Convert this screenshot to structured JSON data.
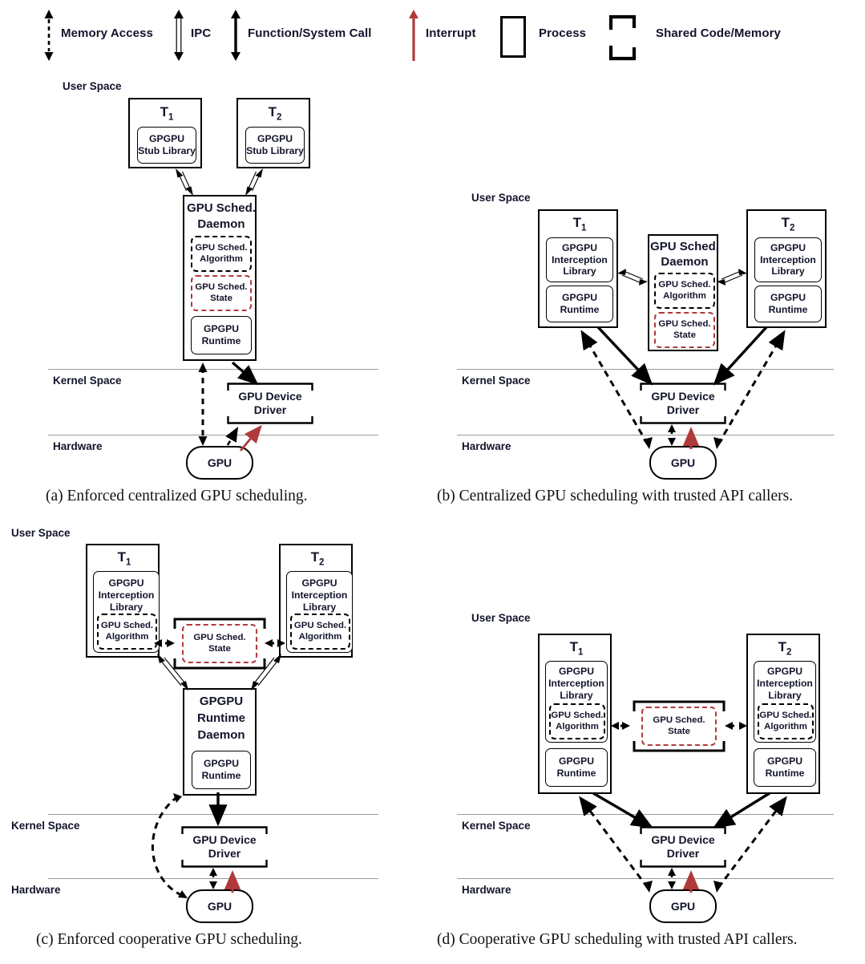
{
  "legend": {
    "items": [
      {
        "icon": "dashed-double-arrow-icon",
        "label": "Memory Access"
      },
      {
        "icon": "hollow-double-arrow-icon",
        "label": "IPC"
      },
      {
        "icon": "solid-double-arrow-icon",
        "label": "Function/System Call"
      },
      {
        "icon": "red-up-arrow-icon",
        "label": "Interrupt"
      },
      {
        "icon": "solid-rect-icon",
        "label": "Process"
      },
      {
        "icon": "corner-bracket-icon",
        "label": "Shared Code/Memory"
      }
    ]
  },
  "labels": {
    "user_space": "User Space",
    "kernel_space": "Kernel Space",
    "hardware": "Hardware",
    "t1": "T",
    "t1_sub": "1",
    "t2": "T",
    "t2_sub": "2",
    "gpu": "GPU",
    "gpu_device_driver_l1": "GPU Device",
    "gpu_device_driver_l2": "Driver",
    "gpgpu": "GPGPU",
    "stub_library": "Stub Library",
    "interception": "Interception",
    "library": "Library",
    "runtime": "Runtime",
    "daemon": "Daemon",
    "gpu_sched": "GPU Sched.",
    "algorithm": "Algorithm",
    "state": "State"
  },
  "figures": {
    "a": {
      "caption": "(a) Enforced centralized GPU scheduling.",
      "t1_modules": [
        "GPGPU",
        "Stub Library"
      ],
      "t2_modules": [
        "GPGPU",
        "Stub Library"
      ],
      "daemon_title": [
        "GPU Sched.",
        "Daemon"
      ],
      "daemon_algorithm": [
        "GPU Sched.",
        "Algorithm"
      ],
      "daemon_state": [
        "GPU Sched.",
        "State"
      ],
      "daemon_runtime": [
        "GPGPU",
        "Runtime"
      ],
      "driver": [
        "GPU Device",
        "Driver"
      ],
      "gpu": "GPU"
    },
    "b": {
      "caption": "(b) Centralized GPU scheduling with trusted API callers.",
      "t1_lib": [
        "GPGPU",
        "Interception",
        "Library"
      ],
      "t1_runtime": [
        "GPGPU",
        "Runtime"
      ],
      "t2_lib": [
        "GPGPU",
        "Interception",
        "Library"
      ],
      "t2_runtime": [
        "GPGPU",
        "Runtime"
      ],
      "daemon_title": [
        "GPU Sched.",
        "Daemon"
      ],
      "daemon_algorithm": [
        "GPU Sched.",
        "Algorithm"
      ],
      "daemon_state": [
        "GPU Sched.",
        "State"
      ],
      "driver": [
        "GPU Device",
        "Driver"
      ],
      "gpu": "GPU"
    },
    "c": {
      "caption": "(c) Enforced cooperative GPU scheduling.",
      "t1_lib": [
        "GPGPU",
        "Interception",
        "Library"
      ],
      "t1_algorithm": [
        "GPU Sched.",
        "Algorithm"
      ],
      "t2_lib": [
        "GPGPU",
        "Interception",
        "Library"
      ],
      "t2_algorithm": [
        "GPU Sched.",
        "Algorithm"
      ],
      "shared_state": [
        "GPU Sched.",
        "State"
      ],
      "daemon_title": [
        "GPGPU",
        "Runtime",
        "Daemon"
      ],
      "daemon_runtime": [
        "GPGPU",
        "Runtime"
      ],
      "driver": [
        "GPU Device",
        "Driver"
      ],
      "gpu": "GPU"
    },
    "d": {
      "caption": "(d) Cooperative GPU scheduling with trusted API callers.",
      "t1_lib": [
        "GPGPU",
        "Interception",
        "Library"
      ],
      "t1_algorithm": [
        "GPU Sched.",
        "Algorithm"
      ],
      "t1_runtime": [
        "GPGPU",
        "Runtime"
      ],
      "t2_lib": [
        "GPGPU",
        "Interception",
        "Library"
      ],
      "t2_algorithm": [
        "GPU Sched.",
        "Algorithm"
      ],
      "t2_runtime": [
        "GPGPU",
        "Runtime"
      ],
      "shared_state": [
        "GPU Sched.",
        "State"
      ],
      "driver": [
        "GPU Device",
        "Driver"
      ],
      "gpu": "GPU"
    }
  },
  "colors": {
    "red": "#b03a3a",
    "black": "#000000",
    "separator": "#9a9a9a",
    "text": "#12142b"
  }
}
